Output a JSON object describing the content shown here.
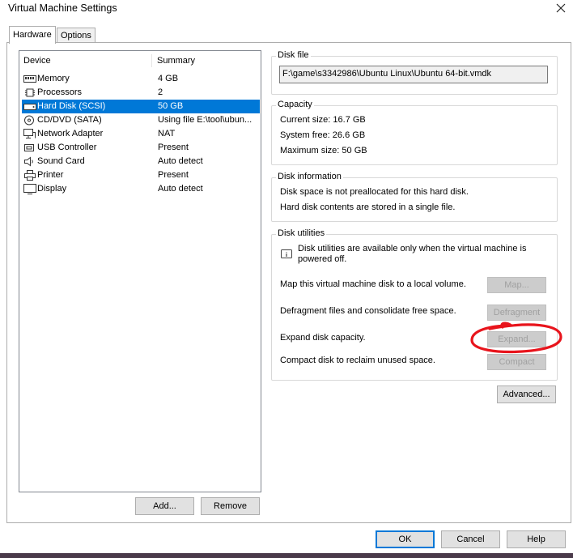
{
  "window": {
    "title": "Virtual Machine Settings"
  },
  "tabs": [
    "Hardware",
    "Options"
  ],
  "device_list": {
    "headers": {
      "device": "Device",
      "summary": "Summary"
    },
    "rows": [
      {
        "name": "Memory",
        "summary": "4 GB",
        "icon": "memory-icon"
      },
      {
        "name": "Processors",
        "summary": "2",
        "icon": "processor-icon"
      },
      {
        "name": "Hard Disk (SCSI)",
        "summary": "50 GB",
        "icon": "hard-disk-icon"
      },
      {
        "name": "CD/DVD (SATA)",
        "summary": "Using file E:\\tool\\ubun...",
        "icon": "cd-dvd-icon"
      },
      {
        "name": "Network Adapter",
        "summary": "NAT",
        "icon": "network-adapter-icon"
      },
      {
        "name": "USB Controller",
        "summary": "Present",
        "icon": "usb-icon"
      },
      {
        "name": "Sound Card",
        "summary": "Auto detect",
        "icon": "speaker-icon"
      },
      {
        "name": "Printer",
        "summary": "Present",
        "icon": "printer-icon"
      },
      {
        "name": "Display",
        "summary": "Auto detect",
        "icon": "display-icon"
      }
    ],
    "selected": "Hard Disk (SCSI)"
  },
  "left_buttons": {
    "add": "Add...",
    "remove": "Remove"
  },
  "disk_file": {
    "label": "Disk file",
    "value": "F:\\game\\s3342986\\Ubuntu Linux\\Ubuntu 64-bit.vmdk"
  },
  "capacity": {
    "label": "Capacity",
    "current": "Current size:  16.7 GB",
    "free": "System free:  26.6 GB",
    "max": "Maximum size:  50 GB"
  },
  "disk_info": {
    "label": "Disk information",
    "line1": "Disk space is not preallocated for this hard disk.",
    "line2": "Hard disk contents are stored in a single file."
  },
  "disk_utilities": {
    "label": "Disk utilities",
    "notice_line1": "Disk utilities are available only when the virtual machine is",
    "notice_line2": "powered off.",
    "map_text": "Map this virtual machine disk to a local volume.",
    "map_button": "Map...",
    "defrag_text": "Defragment files and consolidate free space.",
    "defrag_button": "Defragment",
    "expand_text": "Expand disk capacity.",
    "expand_button": "Expand...",
    "compact_text": "Compact disk to reclaim unused space.",
    "compact_button": "Compact"
  },
  "advanced_button": "Advanced...",
  "footer": {
    "ok": "OK",
    "cancel": "Cancel",
    "help": "Help"
  },
  "colors": {
    "selection": "#0078d7",
    "annotation": "#e8141c"
  }
}
